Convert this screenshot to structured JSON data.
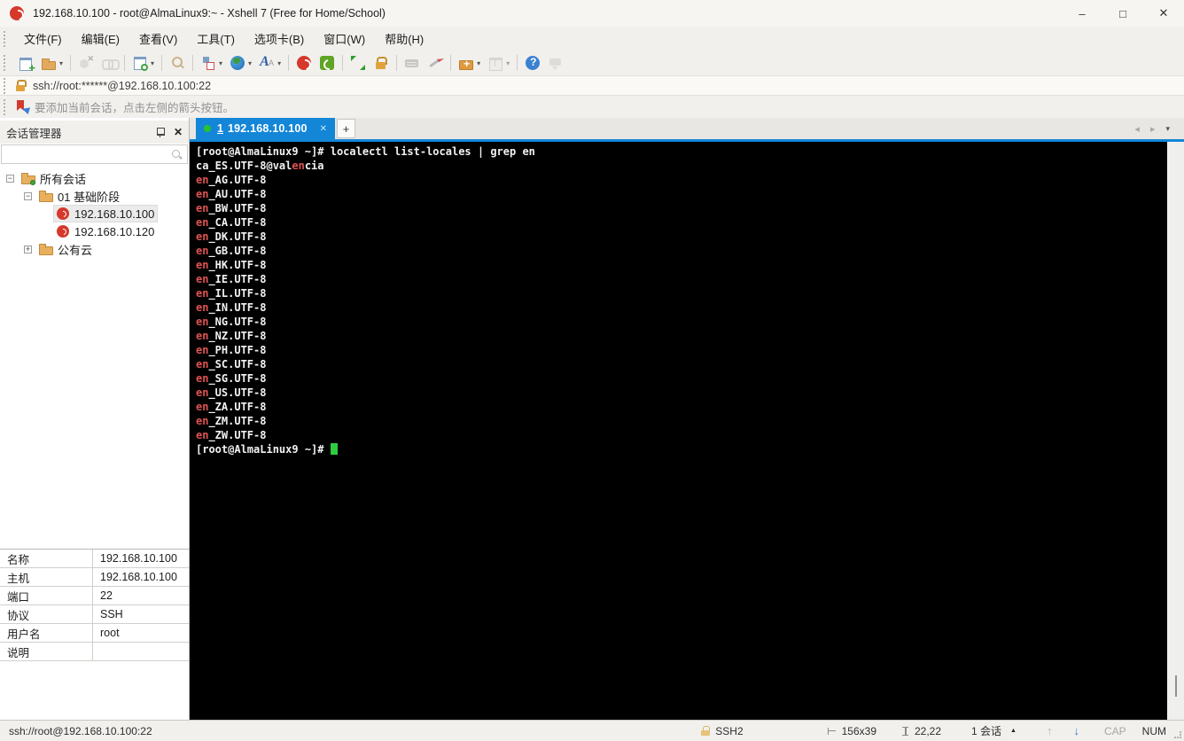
{
  "window": {
    "title": "192.168.10.100 - root@AlmaLinux9:~ - Xshell 7 (Free for Home/School)",
    "controls": {
      "minimize": "–",
      "maximize": "□",
      "close": "✕"
    }
  },
  "menu": {
    "items": [
      "文件(F)",
      "编辑(E)",
      "查看(V)",
      "工具(T)",
      "选项卡(B)",
      "窗口(W)",
      "帮助(H)"
    ]
  },
  "toolbar": {
    "groups": [
      {
        "items": [
          {
            "icon": "new-session-icon"
          },
          {
            "icon": "open-folder-icon",
            "dropdown": true
          }
        ]
      },
      {
        "items": [
          {
            "icon": "disconnect-icon",
            "disabled": true
          },
          {
            "icon": "reconnect-icon",
            "disabled": true
          }
        ]
      },
      {
        "items": [
          {
            "icon": "session-properties-icon",
            "dropdown": true
          }
        ]
      },
      {
        "items": [
          {
            "icon": "find-icon"
          }
        ]
      },
      {
        "items": [
          {
            "icon": "layout-icon",
            "dropdown": true
          },
          {
            "icon": "globe-icon",
            "dropdown": true
          },
          {
            "icon": "font-icon",
            "dropdown": true
          }
        ]
      },
      {
        "items": [
          {
            "icon": "xshell-icon"
          },
          {
            "icon": "xftp-icon"
          }
        ]
      },
      {
        "items": [
          {
            "icon": "fullscreen-icon"
          },
          {
            "icon": "lock-icon"
          }
        ]
      },
      {
        "items": [
          {
            "icon": "keyboard-icon",
            "disabled": true
          },
          {
            "icon": "compose-icon"
          }
        ]
      },
      {
        "items": [
          {
            "icon": "new-folder-icon",
            "dropdown": true
          },
          {
            "icon": "tile-icon",
            "dropdown": true,
            "disabled": true
          }
        ]
      },
      {
        "items": [
          {
            "icon": "help-icon"
          },
          {
            "icon": "feedback-icon",
            "disabled": true
          }
        ]
      }
    ]
  },
  "addressbar": {
    "url": "ssh://root:******@192.168.10.100:22"
  },
  "infobar": {
    "text": "要添加当前会话，点击左侧的箭头按钮。"
  },
  "sidebar": {
    "title": "会话管理器",
    "search_placeholder": "",
    "expander_glyphs": {
      "minus": "−",
      "plus": "+"
    },
    "tree": [
      {
        "label": "所有会话",
        "type": "folder-root",
        "level": 0,
        "expander": "minus"
      },
      {
        "label": "01 基础阶段",
        "type": "folder",
        "level": 1,
        "expander": "minus"
      },
      {
        "label": "192.168.10.100",
        "type": "session",
        "level": 2,
        "selected": true
      },
      {
        "label": "192.168.10.120",
        "type": "session",
        "level": 2
      },
      {
        "label": "公有云",
        "type": "folder",
        "level": 1,
        "expander": "plus"
      }
    ],
    "properties": [
      {
        "key": "名称",
        "value": "192.168.10.100"
      },
      {
        "key": "主机",
        "value": "192.168.10.100"
      },
      {
        "key": "端口",
        "value": "22"
      },
      {
        "key": "协议",
        "value": "SSH"
      },
      {
        "key": "用户名",
        "value": "root"
      },
      {
        "key": "说明",
        "value": ""
      }
    ]
  },
  "tabs": {
    "active_index": "1",
    "active_label": "192.168.10.100",
    "close_glyph": "✕",
    "new_tab_glyph": "+",
    "nav_left": "◂",
    "nav_right": "▸",
    "nav_menu": "▾"
  },
  "terminal": {
    "colors": {
      "bg": "#000000",
      "fg": "#f2f2f2",
      "match": "#e05252",
      "cursor": "#2ecc40"
    },
    "lines": [
      {
        "segs": [
          {
            "t": "[root@AlmaLinux9 ~]# localectl list-locales | grep en",
            "c": "fg"
          }
        ]
      },
      {
        "segs": [
          {
            "t": "ca_ES.UTF-8@val",
            "c": "fg"
          },
          {
            "t": "en",
            "c": "match"
          },
          {
            "t": "cia",
            "c": "fg"
          }
        ]
      },
      {
        "segs": [
          {
            "t": "en",
            "c": "match"
          },
          {
            "t": "_AG.UTF-8",
            "c": "fg"
          }
        ]
      },
      {
        "segs": [
          {
            "t": "en",
            "c": "match"
          },
          {
            "t": "_AU.UTF-8",
            "c": "fg"
          }
        ]
      },
      {
        "segs": [
          {
            "t": "en",
            "c": "match"
          },
          {
            "t": "_BW.UTF-8",
            "c": "fg"
          }
        ]
      },
      {
        "segs": [
          {
            "t": "en",
            "c": "match"
          },
          {
            "t": "_CA.UTF-8",
            "c": "fg"
          }
        ]
      },
      {
        "segs": [
          {
            "t": "en",
            "c": "match"
          },
          {
            "t": "_DK.UTF-8",
            "c": "fg"
          }
        ]
      },
      {
        "segs": [
          {
            "t": "en",
            "c": "match"
          },
          {
            "t": "_GB.UTF-8",
            "c": "fg"
          }
        ]
      },
      {
        "segs": [
          {
            "t": "en",
            "c": "match"
          },
          {
            "t": "_HK.UTF-8",
            "c": "fg"
          }
        ]
      },
      {
        "segs": [
          {
            "t": "en",
            "c": "match"
          },
          {
            "t": "_IE.UTF-8",
            "c": "fg"
          }
        ]
      },
      {
        "segs": [
          {
            "t": "en",
            "c": "match"
          },
          {
            "t": "_IL.UTF-8",
            "c": "fg"
          }
        ]
      },
      {
        "segs": [
          {
            "t": "en",
            "c": "match"
          },
          {
            "t": "_IN.UTF-8",
            "c": "fg"
          }
        ]
      },
      {
        "segs": [
          {
            "t": "en",
            "c": "match"
          },
          {
            "t": "_NG.UTF-8",
            "c": "fg"
          }
        ]
      },
      {
        "segs": [
          {
            "t": "en",
            "c": "match"
          },
          {
            "t": "_NZ.UTF-8",
            "c": "fg"
          }
        ]
      },
      {
        "segs": [
          {
            "t": "en",
            "c": "match"
          },
          {
            "t": "_PH.UTF-8",
            "c": "fg"
          }
        ]
      },
      {
        "segs": [
          {
            "t": "en",
            "c": "match"
          },
          {
            "t": "_SC.UTF-8",
            "c": "fg"
          }
        ]
      },
      {
        "segs": [
          {
            "t": "en",
            "c": "match"
          },
          {
            "t": "_SG.UTF-8",
            "c": "fg"
          }
        ]
      },
      {
        "segs": [
          {
            "t": "en",
            "c": "match"
          },
          {
            "t": "_US.UTF-8",
            "c": "fg"
          }
        ]
      },
      {
        "segs": [
          {
            "t": "en",
            "c": "match"
          },
          {
            "t": "_ZA.UTF-8",
            "c": "fg"
          }
        ]
      },
      {
        "segs": [
          {
            "t": "en",
            "c": "match"
          },
          {
            "t": "_ZM.UTF-8",
            "c": "fg"
          }
        ]
      },
      {
        "segs": [
          {
            "t": "en",
            "c": "match"
          },
          {
            "t": "_ZW.UTF-8",
            "c": "fg"
          }
        ]
      },
      {
        "segs": [
          {
            "t": "[root@AlmaLinux9 ~]# ",
            "c": "fg"
          }
        ],
        "cursor": true
      }
    ]
  },
  "statusbar": {
    "left": "ssh://root@192.168.10.100:22",
    "protocol": "SSH2",
    "size": "156x39",
    "position": "22,22",
    "sessions": "1 会话",
    "sessions_dropdown": "▲",
    "scroll_up": "↑",
    "scroll_down": "↓",
    "caps": "CAP",
    "num": "NUM"
  },
  "colors": {
    "accent": "#1486d8",
    "tab_dot_green": "#27c42a",
    "xshell_red": "#d6382b"
  }
}
